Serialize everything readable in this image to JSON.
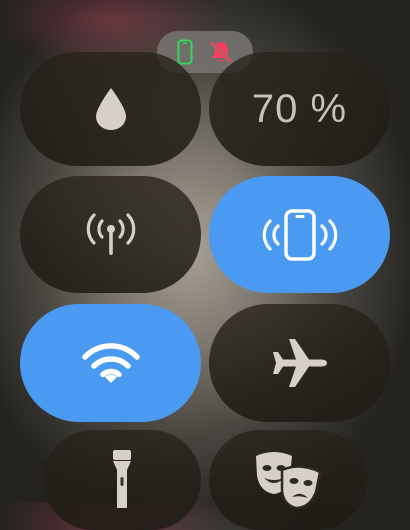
{
  "status": {
    "icons": [
      "phone-connected-icon",
      "silent-mode-icon"
    ],
    "colors": {
      "connected": "#33d65a",
      "silent": "#ff3b5c"
    }
  },
  "controls": [
    {
      "name": "brightness",
      "icon": "water-drop-icon",
      "active": false
    },
    {
      "name": "volume",
      "value_label": "70 %",
      "active": false
    },
    {
      "name": "cellular",
      "icon": "cellular-antenna-icon",
      "active": false
    },
    {
      "name": "ping-iphone",
      "icon": "ping-iphone-icon",
      "active": true
    },
    {
      "name": "wifi",
      "icon": "wifi-icon",
      "active": true
    },
    {
      "name": "airplane-mode",
      "icon": "airplane-icon",
      "active": false
    },
    {
      "name": "flashlight",
      "icon": "flashlight-icon",
      "active": false
    },
    {
      "name": "theater-mode",
      "icon": "theater-masks-icon",
      "active": false
    }
  ],
  "colors": {
    "active_tile": "#4a9af2",
    "icon_light": "#d6d0c6"
  }
}
